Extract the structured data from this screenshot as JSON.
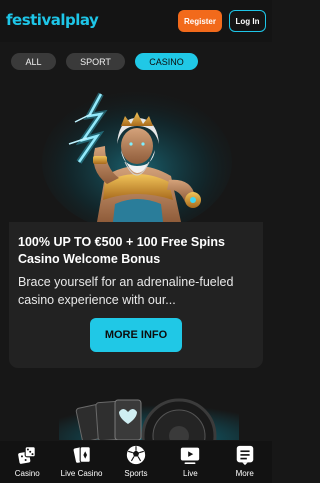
{
  "header": {
    "logo_part1": "festival",
    "logo_part2": "play",
    "register_label": "Register",
    "login_label": "Log In"
  },
  "filters": [
    {
      "label": "ALL",
      "active": false
    },
    {
      "label": "SPORT",
      "active": false
    },
    {
      "label": "CASINO",
      "active": true
    }
  ],
  "promo": {
    "title": "100% UP TO €500 + 100 Free Spins Casino Welcome Bonus",
    "description": "Brace yourself for an adrenaline-fueled casino experience with our...",
    "button_label": "MORE INFO"
  },
  "bottom_nav": [
    {
      "label": "Casino",
      "icon": "dice-icon"
    },
    {
      "label": "Live Casino",
      "icon": "cards-icon"
    },
    {
      "label": "Sports",
      "icon": "soccer-ball-icon"
    },
    {
      "label": "Live",
      "icon": "play-video-icon"
    },
    {
      "label": "More",
      "icon": "list-icon"
    }
  ],
  "colors": {
    "accent": "#20c8e6",
    "register": "#f26a1b",
    "background": "#171717",
    "card": "#222222"
  }
}
